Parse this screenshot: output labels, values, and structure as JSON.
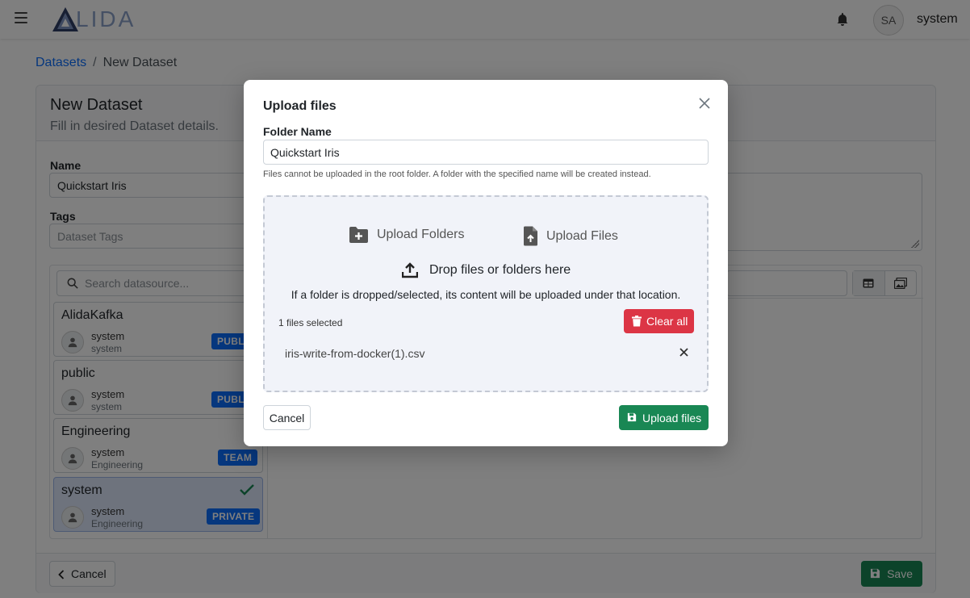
{
  "app": {
    "logo_text": "LIDA",
    "user_initials": "SA",
    "user_name": "system"
  },
  "breadcrumb": {
    "parent": "Datasets",
    "separator": "/",
    "current": "New Dataset"
  },
  "form": {
    "title": "New Dataset",
    "subtitle": "Fill in desired Dataset details.",
    "name_label": "Name",
    "name_value": "Quickstart Iris",
    "tags_label": "Tags",
    "tags_placeholder": "Dataset Tags",
    "search_placeholder": "Search datasource...",
    "cancel_label": "Cancel",
    "save_label": "Save"
  },
  "datasources": [
    {
      "name": "AlidaKafka",
      "owner": "system",
      "group": "system",
      "badge": "PUBLIC",
      "selected": false
    },
    {
      "name": "public",
      "owner": "system",
      "group": "system",
      "badge": "PUBLIC",
      "selected": false
    },
    {
      "name": "Engineering",
      "owner": "system",
      "group": "Engineering",
      "badge": "TEAM",
      "selected": false
    },
    {
      "name": "system",
      "owner": "system",
      "group": "Engineering",
      "badge": "PRIVATE",
      "selected": true
    }
  ],
  "modal": {
    "title": "Upload files",
    "folder_label": "Folder Name",
    "folder_value": "Quickstart Iris",
    "help_text": "Files cannot be uploaded in the root folder. A folder with the specified name will be created instead.",
    "upload_folders_label": "Upload Folders",
    "upload_files_label": "Upload Files",
    "drop_label": "Drop files or folders here",
    "drop_note": "If a folder is dropped/selected, its content will be uploaded under that location.",
    "files_selected": "1 files selected",
    "clear_all_label": "Clear all",
    "files": [
      "iris-write-from-docker(1).csv"
    ],
    "cancel_label": "Cancel",
    "upload_label": "Upload files"
  },
  "colors": {
    "primary": "#0d6efd",
    "success": "#198754",
    "danger": "#dc3545",
    "selected_bg": "#dce7fb"
  }
}
